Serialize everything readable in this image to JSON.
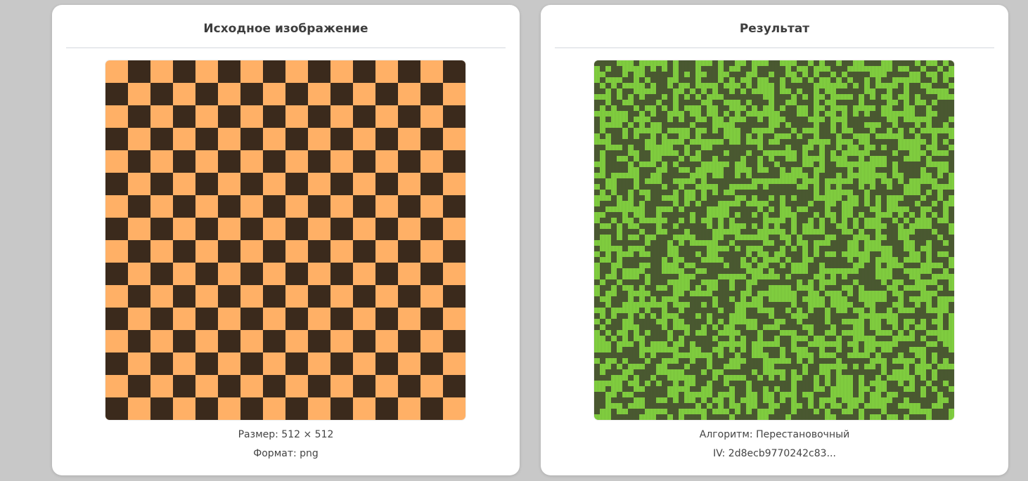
{
  "panels": {
    "original": {
      "title": "Исходное изображение",
      "size_text": "Размер: 512 × 512",
      "format_text": "Формат: png",
      "image": {
        "kind": "checkerboard",
        "grid": 16,
        "colors": {
          "light": "#ffb066",
          "dark": "#3b2a1c"
        }
      }
    },
    "result": {
      "title": "Результат",
      "algorithm_text": "Алгоритм: Перестановочный",
      "iv_text": "IV: 2d8ecb9770242c83...",
      "image": {
        "kind": "scrambled-noise",
        "grid": 64,
        "colors": {
          "light": "#86d941",
          "dark": "#4b5a32",
          "stripe": "#3e4c28"
        }
      }
    }
  }
}
